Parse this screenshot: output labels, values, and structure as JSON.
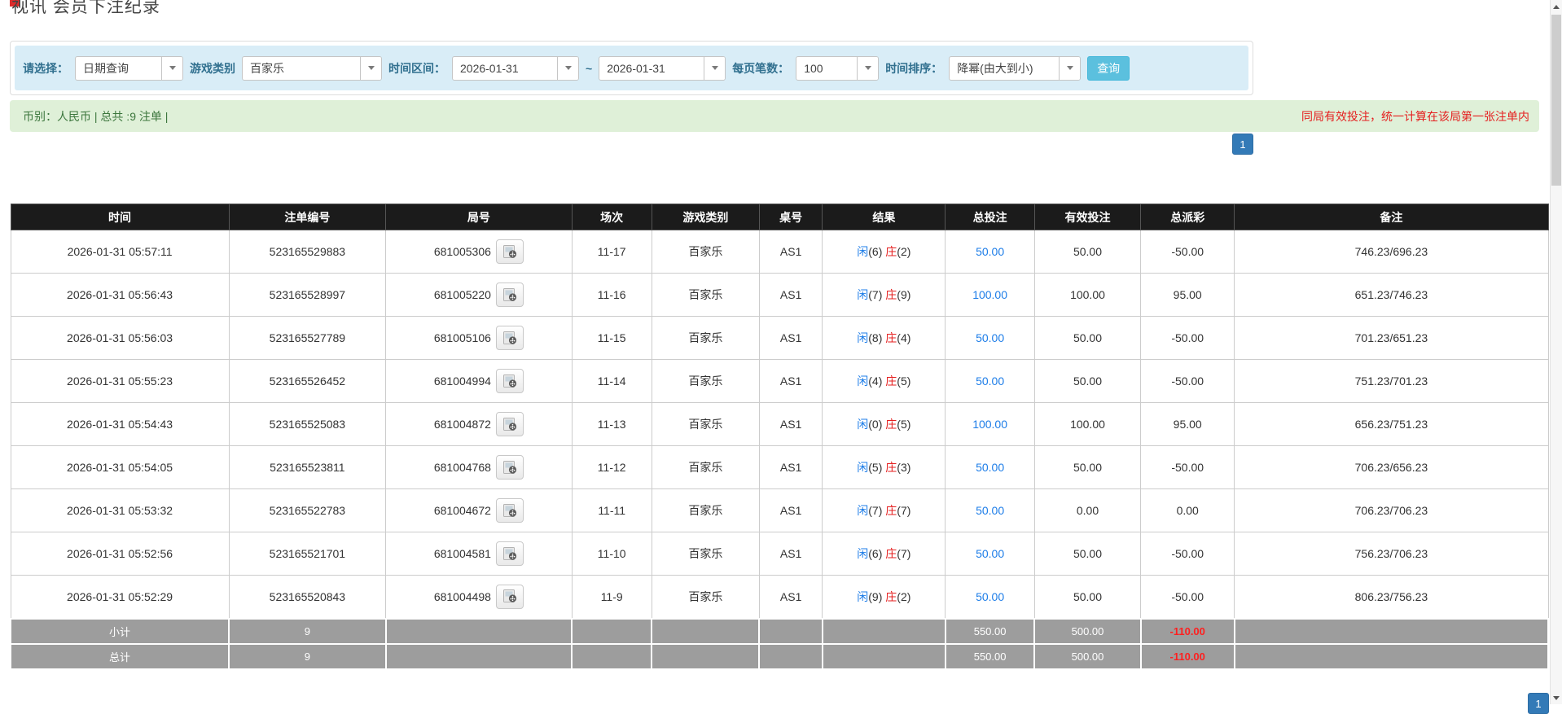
{
  "page": {
    "title": "视讯 会员下注纪录"
  },
  "filter": {
    "select_label": "请选择：",
    "select_value": "日期查询",
    "game_label": "游戏类别",
    "game_value": "百家乐",
    "range_label": "时间区间：",
    "date_from": "2026-01-31",
    "range_separator": "~",
    "date_to": "2026-01-31",
    "per_page_label": "每页笔数：",
    "per_page_value": "100",
    "sort_label": "时间排序：",
    "sort_value": "降幂(由大到小)",
    "search_button": "查询"
  },
  "summary": {
    "left": "币别：人民币 | 总共 :9 注单 |",
    "right": "同局有效投注，统一计算在该局第一张注单内"
  },
  "pagination": {
    "current_page": "1"
  },
  "table": {
    "headers": [
      "时间",
      "注单编号",
      "局号",
      "场次",
      "游戏类别",
      "桌号",
      "结果",
      "总投注",
      "有效投注",
      "总派彩",
      "备注"
    ],
    "rows": [
      {
        "time": "2026-01-31 05:57:11",
        "bet_id": "523165529883",
        "round_id": "681005306",
        "session": "11-17",
        "game": "百家乐",
        "table_no": "AS1",
        "result": {
          "player": "闲",
          "player_score": "(6)",
          "banker": "庄",
          "banker_score": "(2)"
        },
        "total_bet": "50.00",
        "valid_bet": "50.00",
        "payout": "-50.00",
        "remark": "746.23/696.23"
      },
      {
        "time": "2026-01-31 05:56:43",
        "bet_id": "523165528997",
        "round_id": "681005220",
        "session": "11-16",
        "game": "百家乐",
        "table_no": "AS1",
        "result": {
          "player": "闲",
          "player_score": "(7)",
          "banker": "庄",
          "banker_score": "(9)"
        },
        "total_bet": "100.00",
        "valid_bet": "100.00",
        "payout": "95.00",
        "remark": "651.23/746.23"
      },
      {
        "time": "2026-01-31 05:56:03",
        "bet_id": "523165527789",
        "round_id": "681005106",
        "session": "11-15",
        "game": "百家乐",
        "table_no": "AS1",
        "result": {
          "player": "闲",
          "player_score": "(8)",
          "banker": "庄",
          "banker_score": "(4)"
        },
        "total_bet": "50.00",
        "valid_bet": "50.00",
        "payout": "-50.00",
        "remark": "701.23/651.23"
      },
      {
        "time": "2026-01-31 05:55:23",
        "bet_id": "523165526452",
        "round_id": "681004994",
        "session": "11-14",
        "game": "百家乐",
        "table_no": "AS1",
        "result": {
          "player": "闲",
          "player_score": "(4)",
          "banker": "庄",
          "banker_score": "(5)"
        },
        "total_bet": "50.00",
        "valid_bet": "50.00",
        "payout": "-50.00",
        "remark": "751.23/701.23"
      },
      {
        "time": "2026-01-31 05:54:43",
        "bet_id": "523165525083",
        "round_id": "681004872",
        "session": "11-13",
        "game": "百家乐",
        "table_no": "AS1",
        "result": {
          "player": "闲",
          "player_score": "(0)",
          "banker": "庄",
          "banker_score": "(5)"
        },
        "total_bet": "100.00",
        "valid_bet": "100.00",
        "payout": "95.00",
        "remark": "656.23/751.23"
      },
      {
        "time": "2026-01-31 05:54:05",
        "bet_id": "523165523811",
        "round_id": "681004768",
        "session": "11-12",
        "game": "百家乐",
        "table_no": "AS1",
        "result": {
          "player": "闲",
          "player_score": "(5)",
          "banker": "庄",
          "banker_score": "(3)"
        },
        "total_bet": "50.00",
        "valid_bet": "50.00",
        "payout": "-50.00",
        "remark": "706.23/656.23"
      },
      {
        "time": "2026-01-31 05:53:32",
        "bet_id": "523165522783",
        "round_id": "681004672",
        "session": "11-11",
        "game": "百家乐",
        "table_no": "AS1",
        "result": {
          "player": "闲",
          "player_score": "(7)",
          "banker": "庄",
          "banker_score": "(7)"
        },
        "total_bet": "50.00",
        "valid_bet": "0.00",
        "payout": "0.00",
        "remark": "706.23/706.23"
      },
      {
        "time": "2026-01-31 05:52:56",
        "bet_id": "523165521701",
        "round_id": "681004581",
        "session": "11-10",
        "game": "百家乐",
        "table_no": "AS1",
        "result": {
          "player": "闲",
          "player_score": "(6)",
          "banker": "庄",
          "banker_score": "(7)"
        },
        "total_bet": "50.00",
        "valid_bet": "50.00",
        "payout": "-50.00",
        "remark": "756.23/706.23"
      },
      {
        "time": "2026-01-31 05:52:29",
        "bet_id": "523165520843",
        "round_id": "681004498",
        "session": "11-9",
        "game": "百家乐",
        "table_no": "AS1",
        "result": {
          "player": "闲",
          "player_score": "(9)",
          "banker": "庄",
          "banker_score": "(2)"
        },
        "total_bet": "50.00",
        "valid_bet": "50.00",
        "payout": "-50.00",
        "remark": "806.23/756.23"
      }
    ],
    "subtotal": {
      "label": "小计",
      "count": "9",
      "total_bet": "550.00",
      "valid_bet": "500.00",
      "payout": "-110.00"
    },
    "grand_total": {
      "label": "总计",
      "count": "9",
      "total_bet": "550.00",
      "valid_bet": "500.00",
      "payout": "-110.00"
    }
  },
  "colors": {
    "accent_blue": "#1d7de8",
    "negative_red": "#e51f1f",
    "filter_bar_bg": "#d9edf7",
    "filter_label": "#31708f",
    "summary_bg": "#dff0d8",
    "summary_text": "#3c763d",
    "table_header_bg": "#1b1b1b",
    "subtotal_bg": "#9d9d9d",
    "pagination_bg": "#337ab7",
    "search_button_bg": "#5bc0de"
  }
}
